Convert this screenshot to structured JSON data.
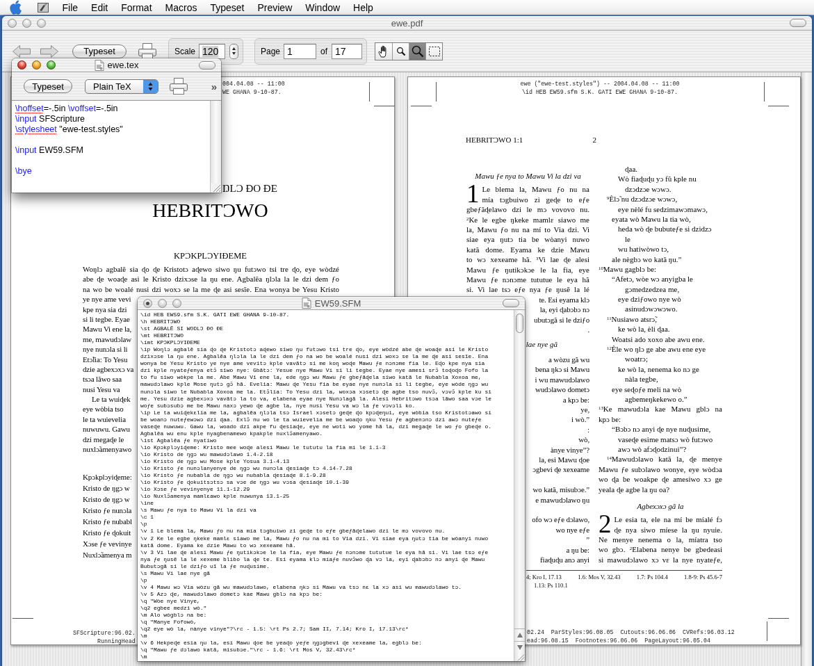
{
  "menu_bar": {
    "items": [
      "File",
      "Edit",
      "Format",
      "Macros",
      "Typeset",
      "Preview",
      "Window",
      "Help"
    ]
  },
  "preview_window": {
    "title": "ewe.pdf",
    "active": false,
    "toolbar": {
      "typeset_button": "Typeset",
      "scale": {
        "label": "Scale",
        "value": "120",
        "highlighted": true
      },
      "page": {
        "label": "Page",
        "value": "1",
        "of_label": "of",
        "total": "17"
      },
      "tools": [
        {
          "kind": "hand",
          "selected": false
        },
        {
          "kind": "small-magnifier",
          "selected": false
        },
        {
          "kind": "magnifier",
          "selected": true
        },
        {
          "kind": "marquee",
          "selected": false
        }
      ]
    },
    "left_page": {
      "header": [
        "004.04.08 -- 11:00",
        "WE GHANA 9-10-87."
      ],
      "title_fragment": "ŊLƆ ƉO ƉE",
      "title": "HEBRITƆWO",
      "intro_heading": "KPƆKPLƆYIƉEME",
      "intro_lines": [
        {
          "kind": "full",
          "text": "Woŋlɔ agbalẽ sia ɖo ɖe Kristotɔ aɖewo siwo ŋu futɔwo tsi tre ɖo, eye wòdzé"
        },
        {
          "kind": "full",
          "text": "abe ɖe woaɖe asi le Kristo dzixɔse la ŋu ene. Agbalẽa ŋlɔla la le dzi dem ƒo"
        },
        {
          "kind": "full",
          "text": "na wo be woalé nusi dzi woxɔ se la me ɖe asi sesĩe. Ena wonya be Yesu Kristo"
        },
        {
          "kind": "cut",
          "text": "ye nye ame vevi"
        },
        {
          "kind": "cut",
          "text": "kpe nya sia dzi"
        },
        {
          "kind": "cut",
          "text": "si li tegbe. Eyae"
        },
        {
          "kind": "cut",
          "text": "Mawu Vi ene la,"
        },
        {
          "kind": "cut",
          "text": "me, mawudɔlaw"
        },
        {
          "kind": "cut",
          "text": "nye nunɔla si li"
        },
        {
          "kind": "cut",
          "text": "Etɔ̃lia: To Yesu"
        },
        {
          "kind": "cut",
          "text": "dzie agbexɔxɔ va"
        },
        {
          "kind": "cut",
          "text": "tsɔa lãwo saa"
        },
        {
          "kind": "cut",
          "text": "nusi Yesu va"
        },
        {
          "kind": "indent",
          "text": "Le ta wuiɖek"
        },
        {
          "kind": "cut",
          "text": "eye wòbia tso"
        },
        {
          "kind": "cut",
          "text": "le ta wuievelia"
        },
        {
          "kind": "cut",
          "text": "nuwuwu. Gawu"
        },
        {
          "kind": "cut",
          "text": "dzi megaɖe le"
        },
        {
          "kind": "cut",
          "text": "nuxlɔ̃amenyawo"
        }
      ],
      "outline_lines": [
        "Kpɔkplɔyiɖeme:",
        "Kristo de ŋgɔ w",
        "Kristo de ŋgɔ w",
        "Kristo ƒe nunɔla",
        "Kristo ƒe nubabl",
        "Kristo ƒe ɖokuit",
        "Xɔse ƒe vevinye",
        "Nuxlɔ̃amenya m"
      ],
      "footer": [
        "SFScripture:96.02.",
        "RunningHead"
      ]
    },
    "right_page": {
      "header": [
        "ewe (\"ewe-test.styles\") -- 2004.04.08 -- 11:00",
        "\\id HEB EW59.sfm S.K. GATI EWE GHANA 9-10-87."
      ],
      "running_head": "HEBRITƆWO 1:1",
      "page_number": "2",
      "left_column": {
        "heading": "Mawu ƒe nya to Mawu Vi la dzi va",
        "chapter": {
          "number": "1",
          "lines": [
            "Le blema la, Mawu ƒo nu na",
            "mía tɔgbuiwo zi geɖe to eƒe"
          ]
        },
        "lines": [
          "gbeƒãɖelawo dzi le mɔ vovovo nu.",
          "$^{2}$Ke le egbe ŋkeke mamlɛ siawo me",
          "la, Mawu ƒo nu na mí to Via dzi. Vi",
          "siae eya ŋutɔ tia be wòanyi nuwo",
          "katã dome. Eyama ke dzie Mawu",
          "to wɔ xexeame hã. $^{3}$Vi lae ɖe alesi",
          "Mawu ƒe ŋutikɔkɔe le la fia, eye",
          "Mawu ƒe nɔnɔme tututue le eya hã",
          "si. Vi lae tsɔ eƒe nya ƒe ŋusẽ la lé"
        ],
        "cut_blocks": [
          {
            "kind": "text",
            "lines": [
              "te. Esi eyama klɔ",
              "la, eyi ɖabɔbɔ nɔ",
              "ubutɔgã si le dziƒo",
              "."
            ]
          },
          {
            "kind": "heading",
            "lines": [
              "lae nye gã"
            ]
          },
          {
            "kind": "text",
            "lines": [
              "a wòzu gã wu",
              "bena ŋkɔ si Mawu",
              "i wu mawudɔlawo",
              "wudɔlawo dometɔ",
              "a kpɔ be:",
              "ye,",
              "i wò.”",
              ":",
              "wò,",
              "ànye vinye”?",
              "la, esi Mawu ɖoe",
              "ɔgbevi ɖe xexeame"
            ]
          },
          {
            "kind": "text",
            "lines": [
              "wo katã, misubɔe.”",
              "e mawudɔlawo ŋu"
            ]
          },
          {
            "kind": "text",
            "lines": [
              "ofo wɔ eƒe dɔlawo,",
              "wo nye eƒe",
              "”",
              "a ŋu be:",
              "fiaɖuɖu anɔ anyi"
            ]
          }
        ]
      },
      "right_column": [
        {
          "kind": "cont",
          "text": "ɖaa."
        },
        {
          "kind": "q2",
          "text": "Wò fiaɖuɖu yɔ fũ kple nu"
        },
        {
          "kind": "cont",
          "text": "dzɔdzɔe wɔwɔ."
        },
        {
          "kind": "q1-verse",
          "text": "$^{9}$Èlɔ̃ nu dzɔdzɔe wɔwɔ,"
        },
        {
          "kind": "q2",
          "text": "eye nèlé fu sedzimawɔmawɔ,"
        },
        {
          "kind": "q1",
          "text": "eyata wò Mawu la tia wò,"
        },
        {
          "kind": "q2",
          "text": "heda wò ɖe bubuteƒe si dzidzɔ"
        },
        {
          "kind": "cont",
          "text": "le"
        },
        {
          "kind": "q2",
          "text": "wu hatiwòwo tɔ,"
        },
        {
          "kind": "q1",
          "text": "ale nègbɔ wo katã ŋu.”"
        },
        {
          "kind": "prose-last",
          "text": "$^{10}$Mawu gagblɔ be:"
        },
        {
          "kind": "q1",
          "text": "“Afetɔ, wòe wɔ anyigba le"
        },
        {
          "kind": "cont",
          "text": "gɔmedzedzea me,"
        },
        {
          "kind": "q2",
          "text": "eye dziƒowo nye wò"
        },
        {
          "kind": "cont",
          "text": "asinudɔwɔwɔwo."
        },
        {
          "kind": "q1-verse",
          "text": "$^{11}$Nusiawo atsrɔ̃,"
        },
        {
          "kind": "q2",
          "text": "ke wò la, èli ɖaa."
        },
        {
          "kind": "q1",
          "text": "Woatsi ado xoxo abe awu ene."
        },
        {
          "kind": "q1-verse",
          "text": "$^{12}$Èle wo ŋlɔ ge abe awu ene eye"
        },
        {
          "kind": "cont",
          "text": "woatrɔ;"
        },
        {
          "kind": "q2",
          "text": "ke wò la, nenema ko nɔ ge"
        },
        {
          "kind": "cont",
          "text": "nàla tegbe,"
        },
        {
          "kind": "q1",
          "text": "eye seɖoƒe meli na wò"
        },
        {
          "kind": "cont",
          "text": "agbemeŋkekewo o.”"
        },
        {
          "kind": "prose",
          "text": "$^{13}$Ke mawudɔla kae Mawu gblɔ na"
        },
        {
          "kind": "prose-last",
          "text": "kpɔ be:"
        },
        {
          "kind": "q1",
          "text": "“Bɔbɔ nɔ anyi ɖe nye nuɖusime,"
        },
        {
          "kind": "q2",
          "text": "vaseɖe esime matsɔ wò futɔwo"
        },
        {
          "kind": "q2",
          "text": "awɔ wò afɔɖodzinui”?"
        },
        {
          "kind": "prose-first",
          "text": "$^{14}$Mawudɔlawo katã la, ɖe menye"
        },
        {
          "kind": "prose",
          "text": "Mawu ƒe subɔlawo wonye, eye wòdɔa"
        },
        {
          "kind": "prose",
          "text": "wo ɖa be woakpe ɖe amesiwo xɔ ge"
        },
        {
          "kind": "prose-last",
          "text": "yeala ɖe agbe la ŋu oa?"
        },
        {
          "kind": "heading",
          "text": "Agbexɔxɔ gã la"
        },
        {
          "kind": "chapter",
          "number": "2",
          "lines": [
            "Le esia ta, ele na mí be míalé fɔ",
            "ɖe nya siwo míese la ŋu nyuie."
          ]
        },
        {
          "kind": "prose",
          "text": "Ne menye nenema o la, míatra tso"
        },
        {
          "kind": "prose",
          "text": "wo gbɔ. $^{2}$Elabena nenye be gbedeasi"
        },
        {
          "kind": "prose",
          "text": "si mawudɔlawo xɔ vɛ la nye nyateƒe,"
        }
      ],
      "footnotes": [
        [
          "4; Kro I, 17.13",
          "1.6: Mos V, 32.43",
          "1.7: Ps 104.4",
          "1.8-9: Ps 45.6-7"
        ],
        [
          "1.13: Ps 110.1"
        ]
      ],
      "footer": [
        "02.24  ParStyles:96.08.05  Cutouts:96.06.06  CVRefs:96.03.12",
        "ead:96.08.15  Footnotes:96.06.06  PageLayout:96.05.04"
      ]
    }
  },
  "source_window": {
    "title": "ewe.tex",
    "active": true,
    "typeset_button": "Typeset",
    "format": "Plain TeX",
    "overflow": "»",
    "lines": [
      {
        "kind": "code",
        "tokens": [
          {
            "kind": "command",
            "text": "\\hoffset",
            "misspelled": true
          },
          {
            "kind": "text",
            "text": "=-.5in ",
            "misspelled": false
          },
          {
            "kind": "command",
            "text": "\\voffset",
            "misspelled": false
          },
          {
            "kind": "text",
            "text": "=-.5in",
            "misspelled": false
          }
        ]
      },
      {
        "kind": "code",
        "tokens": [
          {
            "kind": "command",
            "text": "\\input",
            "misspelled": false
          },
          {
            "kind": "text",
            "text": " SFScripture",
            "misspelled": false
          }
        ]
      },
      {
        "kind": "code",
        "tokens": [
          {
            "kind": "command",
            "text": "\\stylesheet",
            "misspelled": true
          },
          {
            "kind": "text",
            "text": " \"ewe-test.styles\"",
            "misspelled": false
          }
        ]
      },
      {
        "kind": "blank"
      },
      {
        "kind": "code",
        "tokens": [
          {
            "kind": "command",
            "text": "\\input",
            "misspelled": false
          },
          {
            "kind": "text",
            "text": " EW59.SFM",
            "misspelled": false
          }
        ]
      },
      {
        "kind": "blank"
      },
      {
        "kind": "code",
        "tokens": [
          {
            "kind": "command",
            "text": "\\bye",
            "misspelled": false
          }
        ]
      }
    ]
  },
  "sfm_window": {
    "title": "EW59.SFM",
    "active": false,
    "edited": true,
    "lines": [
      "\\id HEB EW59.sfm S.K. GATI EWE GHANA 9-10-87.",
      "\\h HEBRITƆWO",
      "\\st AGBALẼ SI WOŊLƆ ƉO ƉE",
      "\\mt HEBRITƆWO",
      "\\imt KPƆKPLƆYIƉEME",
      "\\ip Woŋlɔ agbalẽ sia ɖo ɖe Kristotɔ aɖewo siwo ŋu futɔwo tsi tre ɖo, eye wòdzé abe ɖe woaɖe asi le Kristo",
      "dzixɔse la ŋu ene. Agbalẽa ŋlɔla la le dzi dem ƒo na wo be woalé nusi dzi woxɔ se la me ɖe asi sesĩe. Ena",
      "wonya be Yesu Kristo ye nye ame vevitɔ kple vavãtɔ si me koŋ woɖe Mawu ƒe nɔnɔme fia le. Eɖo kpe nya sia",
      "dzi kple nyateƒenya etɔ̃ siwo nye: Gbãtɔ: Yesue nye Mawu Vi si li tegbe. Eyae nye amesi srɔ̃ toɖoɖo Fofo la",
      "to fu siwo wòkpe la me. Abe Mawu Vi ene la, ede ŋgɔ wu Mawu ƒe gbeƒãɖela siwo katã le Nubabla Xoxoa me,",
      "mawudɔlawo kple Mose ŋutɔ gɔ̃ hã. Evelia: Mawu ɖe Yesu fia be eyae nye nunɔla si li tegbe, eye wòde ŋgɔ wu",
      "nunɔla siwo le Nubabla Xoxoa me la. Etɔ̃lia: To Yesu dzi la, woxɔa xɔsetɔ ɖe agbe tso nuvɔ̃, vɔvɔ̃ kple ku si",
      "me. Yesu dzie agbexɔxɔ vavãtɔ la to va, elabena eyae nye Nunɔlagã la. Alesi Hebritɔwo tsɔa lãwo saa vɔe le",
      "woƒe subɔsubɔ me be Mawu naxɔ yewo ɖe agbe la, nye nusi Yesu va wɔ la ƒe vɔvɔli ko.",
      "\\ip Le ta wuiɖekɛlia me la, agbalẽa ŋlɔla tsɔ Israel xɔsetɔ geɖe ɖo kpɔɖeŋui, eye wòbia tso Kristotɔawo si",
      "be woanɔ nuteƒewɔwɔ dzi ɖaa. Exlɔ̃ nu wo le ta wuievelia me be woaɖo ŋku Yesu ƒe agbenɔnɔ dzi awɔ nuteƒe",
      "vaseɖe nuwuwu. Gawu la, woado dzi akpe fu ɖesiaɖe, eye ne woti wo yome hã la, dzi megaɖe le wo ƒo gbeɖe o.",
      "Agbalẽa wu enu kple nyagbenamewo kpakple nuxlɔ̃amenyawo.",
      "\\ist Agbalẽa ƒe nyatiwo",
      "\\io Kpɔkplɔyiɖeme: Kristo mee woɖe alesi Mawu le tututu la fia mí le 1.1-3",
      "\\io Kristo de ŋgɔ wu mawudɔlawo 1.4-2.18",
      "\\io Kristo de ŋgɔ wu Mose kple Yosua 3.1-4.13",
      "\\io Kristo ƒe nunɔlanyenye de ŋgɔ wu nunɔla ɖesiaɖe tɔ 4.14-7.28",
      "\\io Kristo ƒe nubabla de ŋgɔ wu nubabla ɖesiaɖe 8.1-9.28",
      "\\io Kristo ƒe ɖokuitsɔtsɔ sa vɔe de ŋgɔ wu vɔsa ɖesiaɖe 10.1-39",
      "\\io Xɔse ƒe vevinyenye 11.1-12.29",
      "\\io Nuxlɔ̃amenya mamlɛawo kple nuwunya 13.1-25",
      "\\ine",
      "\\s Mawu ƒe nya to Mawu Vi la dzi va",
      "\\c 1",
      "\\p",
      "\\v 1 Le blema la, Mawu ƒo nu na mía tɔgbuiwo zi geɖe to eƒe gbeƒãɖelawo dzi le mɔ vovovo nu.",
      "\\v 2 Ke le egbe ŋkeke mamlɛ siawo me la, Mawu ƒo nu na mí to Via dzi. Vi siae eya ŋutɔ tia be wòanyi nuwo",
      "katã dome. Eyama ke dzie Mawu to wɔ xexeame hã.",
      "\\v 3 Vi lae ɖe alesi Mawu ƒe ŋutikɔkɔe le la fia, eye Mawu ƒe nɔnɔme tututue le eya hã si. Vi lae tsɔ eƒe",
      "nya ƒe ŋusẽ la lé xexeme blibo la ɖe te. Esi eyama klɔ míaƒe nuvɔ̃wo ɖa vɔ la, eyi ɖabɔbɔ nɔ anyi ɖe Mawu",
      "Bubutɔgã si le dziƒo ʋĩ la ƒe nuɖusime.",
      "\\s Mawu Vi lae nye gã",
      "\\p",
      "\\v 4 Mawu wɔ Via wòzu gã wu mawudɔlawo, elabena ŋkɔ si Mawu va tsɔ nɛ la xɔ asi wu mawudɔlawo tɔ.",
      "\\v 5 Azɔ ɖe, mawudɔlawo dometɔ kae Mawu gblɔ na kpɔ be:",
      "\\q \"Wòe nye Vinye,",
      "\\q2 egbee medzi wò.\"",
      "\\m Alo wògblɔ na be:",
      "\\q \"Manye Fofowò,",
      "\\q2 eye wò la, nànye vinye\"?\\rc - 1.5: \\rt Ps 2.7; Sam II, 7.14; Kro I, 17.13\\rc*",
      "\\m",
      "\\v 6 Hekpeɖe esia ŋu la, esi Mawu ɖoe be yeaɖo yeƒe ŋgɔgbevi ɖe xexeame la, egblɔ be:",
      "\\q \"Mawu ƒe dɔlawo katã, misubɔe.\"\\rc - 1.6: \\rt Mos V, 32.43\\rc*",
      "\\m"
    ]
  }
}
